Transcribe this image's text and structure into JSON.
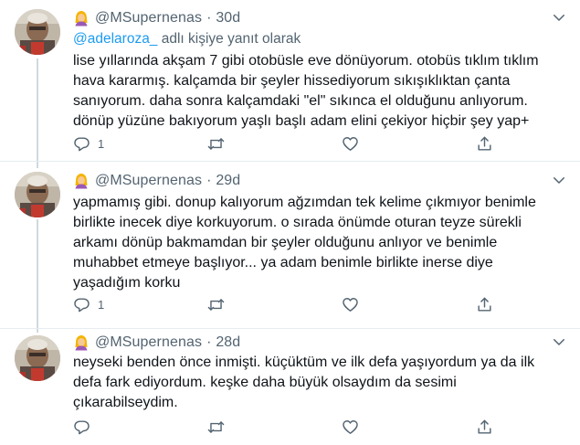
{
  "tweets": [
    {
      "handle": "@MSupernenas",
      "separator": "·",
      "time": "30d",
      "reply_to_user": "@adelaroza_",
      "reply_suffix": " adlı kişiye yanıt olarak",
      "lines": [
        "lise yıllarında akşam 7 gibi otobüsle eve dönüyorum. otobüs tıklım tıklım",
        "hava kararmış. kalçamda bir şeyler hissediyorum sıkışıklıktan çanta",
        "sanıyorum. daha sonra kalçamdaki \"el\" sıkınca el olduğunu anlıyorum.",
        "dönüp yüzüne bakıyorum yaşlı başlı adam elini çekiyor hiçbir şey yap+"
      ],
      "reply_count": "1",
      "retweet_count": "",
      "like_count": ""
    },
    {
      "handle": "@MSupernenas",
      "separator": "·",
      "time": "29d",
      "lines": [
        "yapmamış gibi. donup kalıyorum ağzımdan tek kelime çıkmıyor benimle",
        "birlikte inecek diye korkuyorum. o sırada önümde oturan teyze sürekli",
        "arkamı dönüp bakmamdan bir şeyler olduğunu anlıyor ve benimle",
        "muhabbet etmeye başlıyor... ya adam benimle birlikte inerse diye",
        "yaşadığım korku"
      ],
      "reply_count": "1",
      "retweet_count": "",
      "like_count": ""
    },
    {
      "handle": "@MSupernenas",
      "separator": "·",
      "time": "28d",
      "lines": [
        "neyseki benden önce inmişti. küçüktüm ve ilk defa yaşıyordum ya da ilk",
        "defa fark ediyordum. keşke daha büyük olsaydım da sesimi",
        "çıkarabilseydim."
      ],
      "reply_count": "",
      "retweet_count": "",
      "like_count": ""
    }
  ],
  "icons": {
    "badge": "woman-emoji-icon",
    "caret": "chevron-down-icon",
    "reply": "reply-icon",
    "retweet": "retweet-icon",
    "like": "heart-icon",
    "share": "share-icon"
  },
  "colors": {
    "text": "#0f1419",
    "secondary": "#536471",
    "link": "#1d9bf0",
    "divider": "#e6ecf0",
    "thread_line": "#cfd9de"
  }
}
